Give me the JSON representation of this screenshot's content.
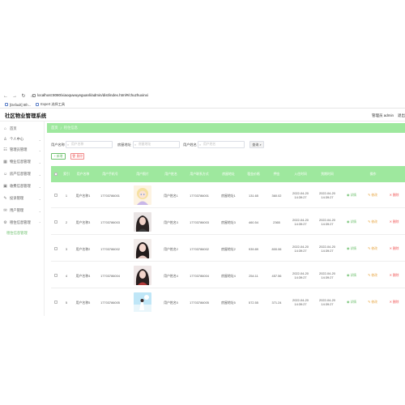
{
  "browser": {
    "nav": [
      "←",
      "→",
      "↻",
      "⌂"
    ],
    "url": "localhost:8080/xiaoquwuyeguanli/admin/dist/index.html#/chuzhuxinxi",
    "tabs": [
      {
        "label": "[Default] 8th..."
      },
      {
        "label": "Expert 选择工具"
      }
    ]
  },
  "app": {
    "title": "社区物业管理系统",
    "user": "管理员 admin",
    "exit": "退出"
  },
  "sidebar": {
    "items": [
      {
        "icon": "home-icon",
        "glyph": "⌂",
        "label": "首页"
      },
      {
        "icon": "user-icon",
        "glyph": "♙",
        "label": "个人中心"
      },
      {
        "icon": "users-icon",
        "glyph": "☷",
        "label": "管理员管理"
      },
      {
        "icon": "community-icon",
        "glyph": "▦",
        "label": "物业信息管理"
      },
      {
        "icon": "owner-icon",
        "glyph": "☺",
        "label": "房产信息管理"
      },
      {
        "icon": "parking-icon",
        "glyph": "▣",
        "label": "收费信息管理"
      },
      {
        "icon": "repair-icon",
        "glyph": "✎",
        "label": "投诉管理"
      },
      {
        "icon": "notice-icon",
        "glyph": "✉",
        "label": "用户管理"
      },
      {
        "icon": "settings-icon",
        "glyph": "⚙",
        "label": "租住信息管理"
      }
    ],
    "subitem": "租住信息管理"
  },
  "breadcrumb": {
    "home": "首页",
    "current": "租住信息"
  },
  "search": {
    "fields": [
      {
        "label": "用户名称",
        "placeholder": "用户名称"
      },
      {
        "label": "房屋地址",
        "placeholder": "房屋地址"
      },
      {
        "label": "用户姓名",
        "placeholder": "用户姓名"
      }
    ],
    "button": "查询"
  },
  "actions": {
    "add": "+ 新增",
    "delete": "删除"
  },
  "table": {
    "headers": [
      "索引",
      "用户名称",
      "用户手机号",
      "用户照片",
      "用户姓名",
      "用户联系方式",
      "房屋地址",
      "租金价格",
      "押金",
      "入住时间",
      "到期时间",
      "操作"
    ],
    "rows": [
      {
        "index": "1",
        "name": "用户名称1",
        "phone": "17703786001",
        "owner": "用户姓名1",
        "contact": "17703786001",
        "address": "房屋地址1",
        "rent": "131.65",
        "deposit": "360.02",
        "start": "2022-04-20 14:39:27",
        "end": "2022-04-20 14:39:27"
      },
      {
        "index": "2",
        "name": "用户名称3",
        "phone": "17703786003",
        "owner": "用户姓名3",
        "contact": "17703786003",
        "address": "房屋地址3",
        "rent": "460.54",
        "deposit": "2365",
        "start": "2022-04-20 14:39:27",
        "end": "2022-04-20 14:39:27"
      },
      {
        "index": "3",
        "name": "用户名称2",
        "phone": "17703786002",
        "owner": "用户姓名2",
        "contact": "17703786002",
        "address": "房屋地址2",
        "rent": "939.89",
        "deposit": "800.06",
        "start": "2022-04-20 14:39:27",
        "end": "2022-04-20 14:39:27"
      },
      {
        "index": "4",
        "name": "用户名称4",
        "phone": "17703786004",
        "owner": "用户姓名4",
        "contact": "17703786004",
        "address": "房屋地址4",
        "rent": "254.11",
        "deposit": "457.56",
        "start": "2022-04-20 14:39:27",
        "end": "2022-04-20 14:39:27"
      },
      {
        "index": "5",
        "name": "用户名称5",
        "phone": "17703786005",
        "owner": "用户姓名5",
        "contact": "17703786005",
        "address": "房屋地址5",
        "rent": "572.55",
        "deposit": "371.24",
        "start": "2022-04-20 14:39:27",
        "end": "2022-04-20 14:39:27"
      }
    ],
    "actions": {
      "view": "详情",
      "edit": "修改",
      "delete": "删除"
    }
  },
  "colors": {
    "accent": "#9ee89e",
    "success": "#6ec06e",
    "warning": "#e6a23c",
    "danger": "#f05656"
  }
}
